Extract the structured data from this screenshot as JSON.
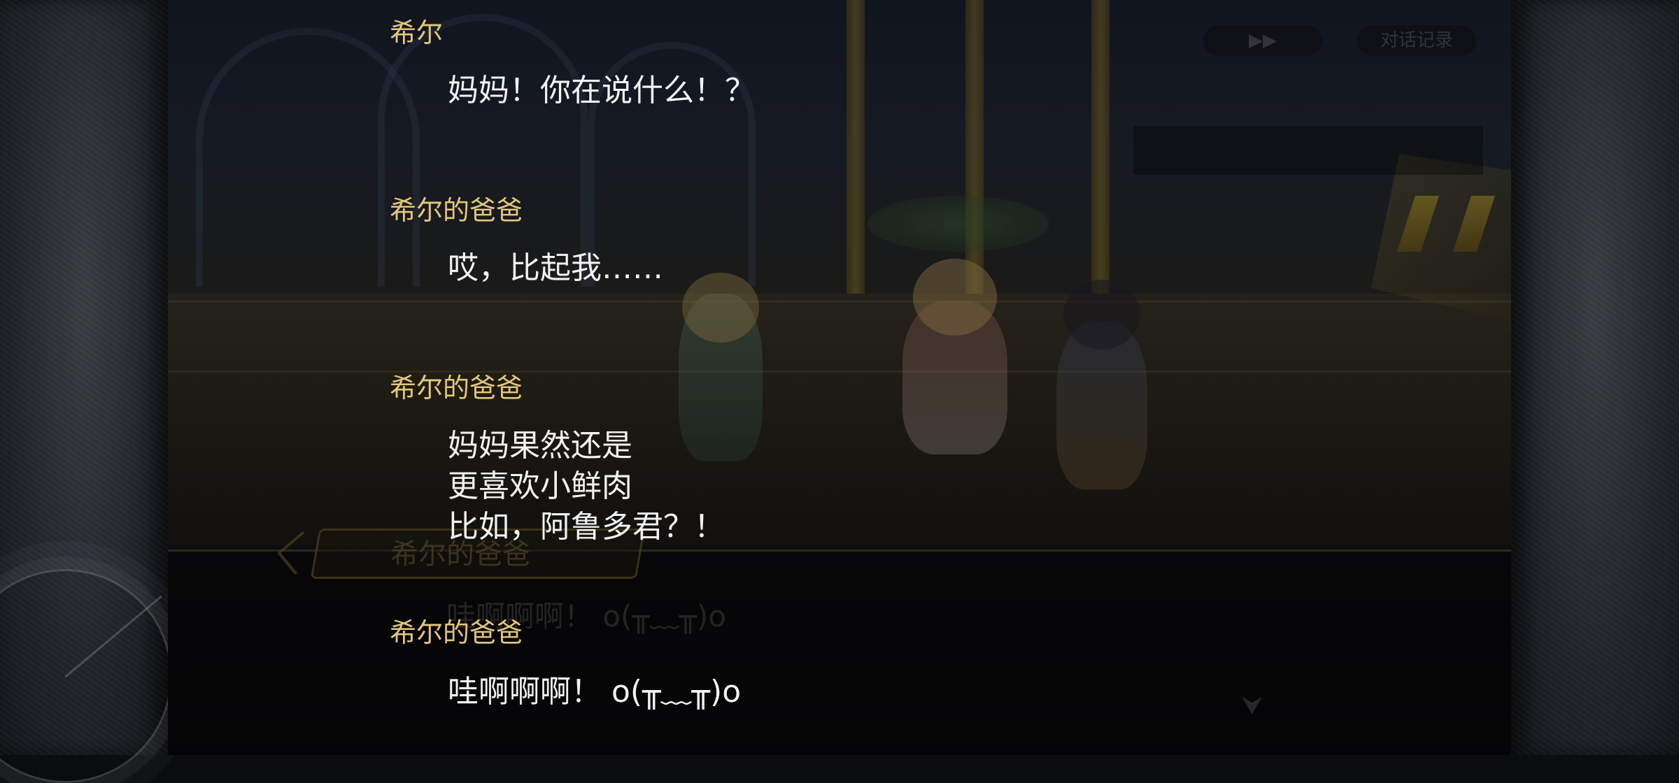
{
  "top_bar": {
    "skip_label": "▶▶",
    "log_label": "对话记录"
  },
  "background_dialog": {
    "speaker": "希尔的爸爸",
    "line": "哇啊啊啊！ o(╥﹏╥)o"
  },
  "log": [
    {
      "speaker": "希尔",
      "lines": [
        "妈妈！你在说什么！？"
      ]
    },
    {
      "speaker": "希尔的爸爸",
      "lines": [
        "哎，比起我……"
      ]
    },
    {
      "speaker": "希尔的爸爸",
      "lines": [
        "妈妈果然还是",
        "更喜欢小鲜肉",
        "比如，阿鲁多君？！"
      ]
    },
    {
      "speaker": "希尔的爸爸",
      "lines": [
        "哇啊啊啊！ o(╥﹏╥)o"
      ]
    }
  ]
}
